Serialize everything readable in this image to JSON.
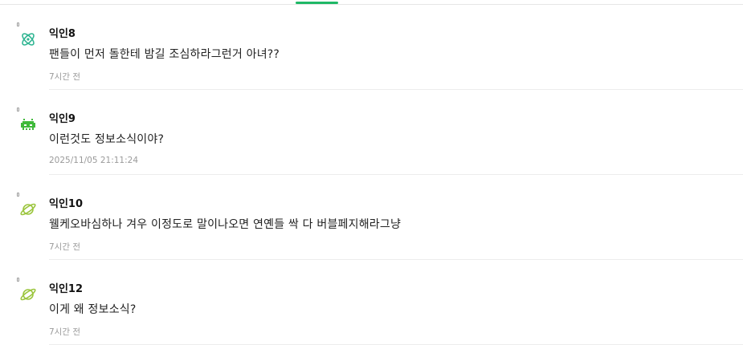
{
  "comments": [
    {
      "nickname": "익인8",
      "avatar_icon": "atom-icon",
      "avatar_color": "#2fb592",
      "text": "팬들이 먼저 돌한테 밤길 조심하라그런거 아녀??",
      "time": "7시간 전"
    },
    {
      "nickname": "익인9",
      "avatar_icon": "space-invader-icon",
      "avatar_color": "#3fb93a",
      "text": "이런것도 정보소식이야?",
      "time": "2025/11/05 21:11:24"
    },
    {
      "nickname": "익인10",
      "avatar_icon": "planet-icon",
      "avatar_color": "#9bc53d",
      "text": "웰케오바심하나 겨우 이정도로 말이나오면 연옌들 싹 다 버블페지해라그냥",
      "time": "7시간 전"
    },
    {
      "nickname": "익인12",
      "avatar_icon": "planet-icon",
      "avatar_color": "#9bc53d",
      "text": "이게 왜 정보소식?",
      "time": "7시간 전"
    }
  ],
  "tab_indicator_color": "#1fb866"
}
